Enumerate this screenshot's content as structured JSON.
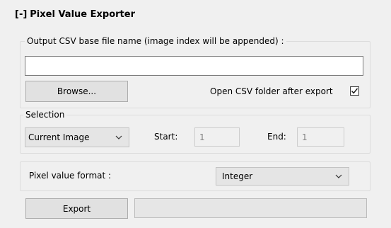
{
  "panel": {
    "toggle": "[-]",
    "title": "Pixel Value Exporter"
  },
  "output": {
    "group_label": "Output CSV base file name (image index will be appended) :",
    "file_name_value": "",
    "browse_label": "Browse...",
    "open_folder_label": "Open CSV folder after export",
    "open_folder_checked": true
  },
  "selection": {
    "group_label": "Selection",
    "mode_value": "Current Image",
    "start_label": "Start:",
    "start_value": "1",
    "end_label": "End:",
    "end_value": "1"
  },
  "format": {
    "label": "Pixel value format :",
    "value": "Integer"
  },
  "export": {
    "button_label": "Export",
    "progress": 0
  },
  "icons": {
    "dropdown": "chevron-down-icon",
    "check": "checkmark-icon"
  }
}
